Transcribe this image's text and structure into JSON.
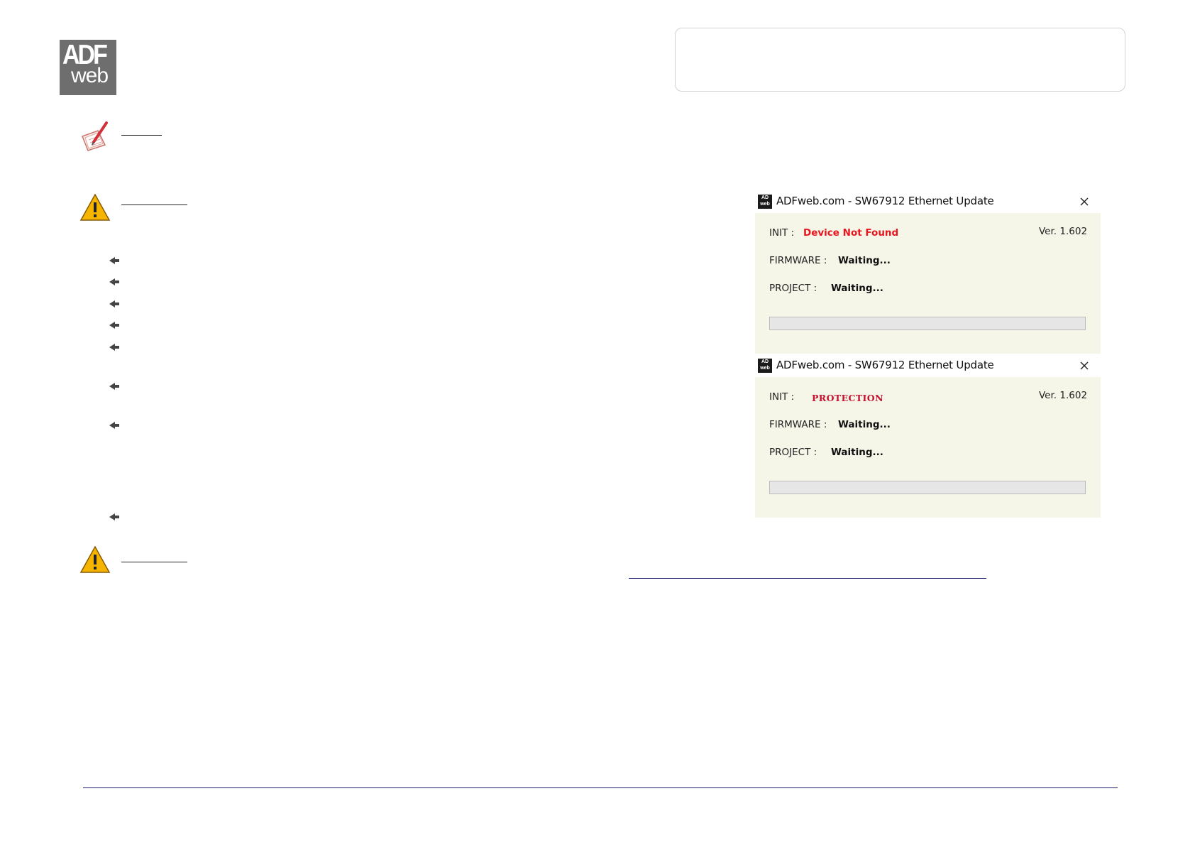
{
  "logo": {
    "top_text": "ADF",
    "bottom_text": "web"
  },
  "dialogs": [
    {
      "title": "ADFweb.com - SW67912 Ethernet Update",
      "version": "Ver. 1.602",
      "init_label": "INIT :",
      "init_value": "Device Not Found",
      "firmware_label": "FIRMWARE :",
      "firmware_value": "Waiting...",
      "project_label": "PROJECT :",
      "project_value": "Waiting...",
      "progress": 0
    },
    {
      "title": "ADFweb.com - SW67912 Ethernet Update",
      "version": "Ver. 1.602",
      "init_label": "INIT :",
      "init_value": "PROTECTION",
      "firmware_label": "FIRMWARE :",
      "firmware_value": "Waiting...",
      "project_label": "PROJECT :",
      "project_value": "Waiting...",
      "progress": 0
    }
  ],
  "icons": {
    "note": "note-pencil-icon",
    "warning": "warning-icon",
    "bullet": "arrow-bullet-icon",
    "close": "close-icon",
    "app": "adfweb-app-icon"
  },
  "colors": {
    "accent_line": "#1f1f6e",
    "error_red": "#e8141e",
    "dialog_bg": "#f5f5e8",
    "warning_yellow": "#f5b400"
  }
}
